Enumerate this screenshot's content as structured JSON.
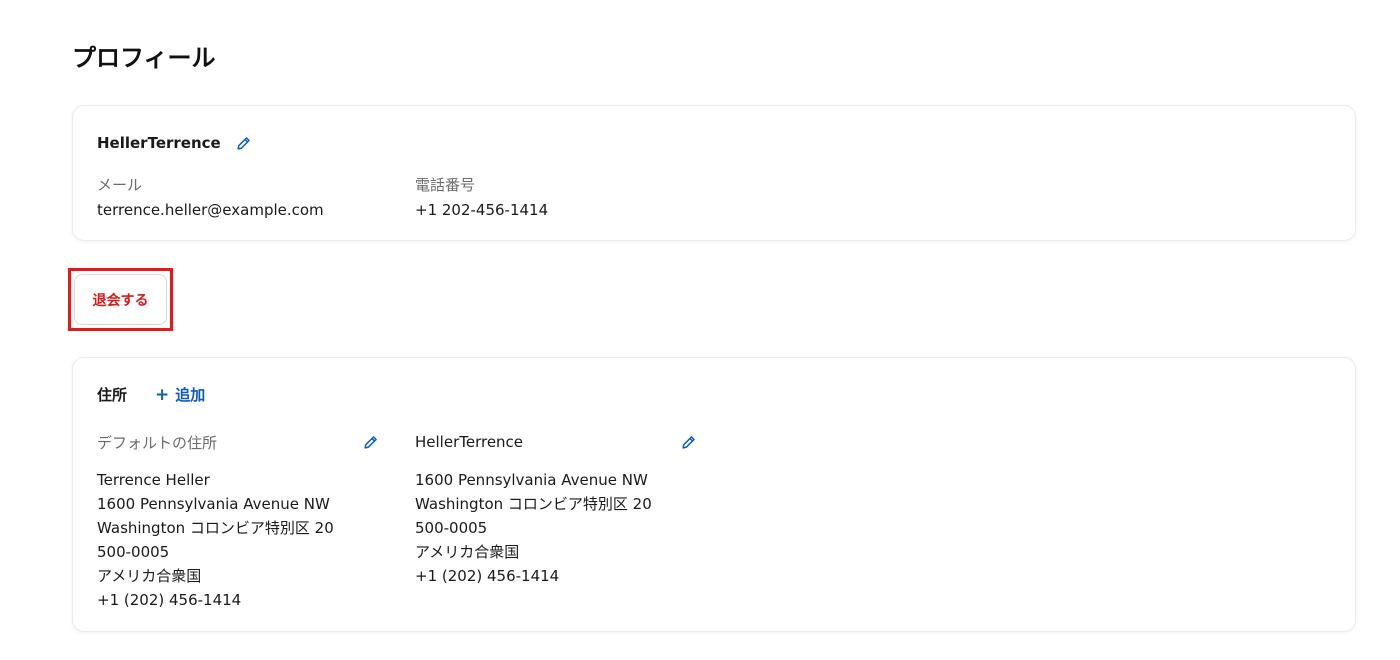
{
  "page": {
    "title": "プロフィール"
  },
  "profile": {
    "name": "HellerTerrence",
    "email_label": "メール",
    "email_value": "terrence.heller@example.com",
    "phone_label": "電話番号",
    "phone_value": "+1 202-456-1414"
  },
  "withdraw": {
    "label": "退会する"
  },
  "addresses": {
    "title": "住所",
    "add_label": "追加",
    "add_plus": "+",
    "items": [
      {
        "heading": "デフォルトの住所",
        "lines": [
          "Terrence Heller",
          "1600 Pennsylvania Avenue NW",
          "Washington コロンビア特別区 20",
          "500-0005",
          "アメリカ合衆国",
          "+1 (202) 456-1414"
        ]
      },
      {
        "heading": "HellerTerrence",
        "lines": [
          "1600 Pennsylvania Avenue NW",
          "Washington コロンビア特別区 20",
          "500-0005",
          "アメリカ合衆国",
          "+1 (202) 456-1414"
        ]
      }
    ]
  },
  "icons": {
    "edit": "pencil-icon",
    "add": "plus-icon"
  },
  "colors": {
    "accent": "#0b5bc4",
    "danger": "#d81b1b",
    "highlight": "#e21a1a"
  }
}
